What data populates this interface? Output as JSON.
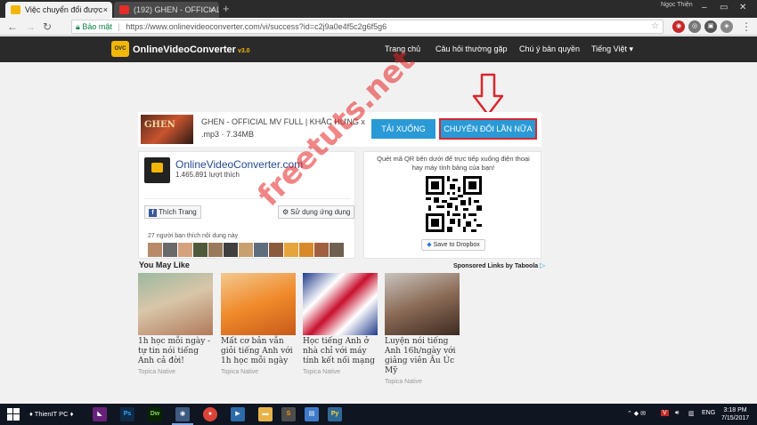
{
  "browser": {
    "tabs": [
      {
        "title": "Việc chuyển đổi được",
        "icon": "converter-favicon-icon",
        "active": true
      },
      {
        "title": "(192) GHEN - OFFICIAL",
        "icon": "youtube-favicon-icon",
        "active": false
      }
    ],
    "user": "Ngọc Thiện",
    "secure_label": "Bảo mật",
    "url": "https://www.onlinevideoconverter.com/vi/success?id=c2j9a0e4f5c2g6f5g6"
  },
  "site": {
    "logo_badge": "OVC",
    "logo_text": "OnlineVideoConverter",
    "logo_version": "v3.0",
    "nav": [
      "Trang chủ",
      "Câu hỏi thường gặp",
      "Chú ý bản quyền",
      "Tiếng Việt"
    ]
  },
  "result": {
    "thumb_text": "GHEN",
    "title": "GHEN - OFFICIAL MV FULL | KHẮC HƯNG x MI...",
    "meta": ".mp3 · 7.34MB",
    "download_label": "TẢI XUỐNG",
    "convert_again_label": "CHUYỂN ĐỔI LẦN NỮA"
  },
  "facebook": {
    "page_name": "OnlineVideoConverter.com",
    "likes": "1.465.891 lượt thích",
    "like_button": "Thích Trang",
    "use_app_button": "Sử dụng ứng dụng",
    "friends_text": "27 người bạn thích nội dung này"
  },
  "qr": {
    "text": "Quét mã QR bên dưới để trực tiếp xuống điện thoại hay máy tính bảng của bạn!",
    "dropbox_label": "Save to Dropbox"
  },
  "recommend": {
    "heading": "You May Like",
    "sponsored": "Sponsored Links by Taboola",
    "cards": [
      {
        "caption": "1h học mỗi ngày - tự tin nói tiếng Anh cả đời!",
        "source": "Topica Native"
      },
      {
        "caption": "Mất cơ bản vẫn giỏi tiếng Anh với 1h học mỗi ngày",
        "source": "Topica Native"
      },
      {
        "caption": "Học tiếng Anh ở nhà chỉ với máy tính kết nối mạng",
        "source": "Topica Native"
      },
      {
        "caption": "Luyện nói tiếng Anh 16h/ngày với giảng viên Âu Úc Mỹ",
        "source": "Topica Native"
      }
    ]
  },
  "watermark": "freetuts.net",
  "taskbar": {
    "label": "♦ ThienIT PC ♦",
    "apps": [
      "VS",
      "Ps",
      "Dw",
      "Chrome",
      "Chrome",
      "Media",
      "Explorer",
      "Sublime",
      "Files",
      "Python"
    ],
    "lang": "ENG",
    "time": "3:18 PM",
    "date": "7/15/2017"
  }
}
